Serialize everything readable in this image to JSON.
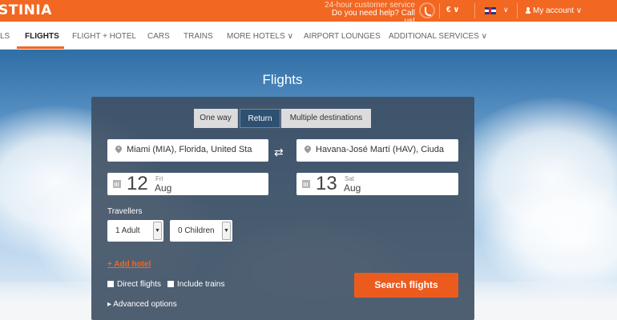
{
  "brand": {
    "logo_text": "STINIA"
  },
  "topbar": {
    "service_line1": "24-hour customer service",
    "service_line2": "Do you need help? Call us!",
    "currency": "€ ∨",
    "language_chevron": "∨",
    "account": "My account ∨"
  },
  "nav": {
    "items": [
      {
        "label": "LS"
      },
      {
        "label": "FLIGHTS"
      },
      {
        "label": "FLIGHT + HOTEL"
      },
      {
        "label": "CARS"
      },
      {
        "label": "TRAINS"
      },
      {
        "label": "MORE HOTELS ∨"
      },
      {
        "label": "AIRPORT LOUNGES"
      },
      {
        "label": "ADDITIONAL SERVICES ∨"
      }
    ],
    "active": "FLIGHTS"
  },
  "hero": {
    "title": "Flights"
  },
  "search": {
    "trip_types": [
      "One way",
      "Return",
      "Multiple destinations"
    ],
    "selected_trip_type": "Return",
    "origin": "Miami (MIA), Florida, United Sta",
    "destination": "Havana-José Martí (HAV), Ciuda",
    "swap_symbol": "⇄",
    "depart": {
      "day": "12",
      "weekday": "Fri",
      "month": "Aug"
    },
    "return": {
      "day": "13",
      "weekday": "Sat",
      "month": "Aug"
    },
    "travellers_label": "Travellers",
    "adults": "1 Adult",
    "children": "0 Children",
    "add_hotel": "+ Add hotel",
    "direct_flights": "Direct flights",
    "include_trains": "Include trains",
    "advanced_options": "▸ Advanced options",
    "search_button": "Search flights"
  },
  "colors": {
    "brand_orange": "#f26722",
    "panel": "#3d4f63",
    "button": "#ec5b1e"
  }
}
